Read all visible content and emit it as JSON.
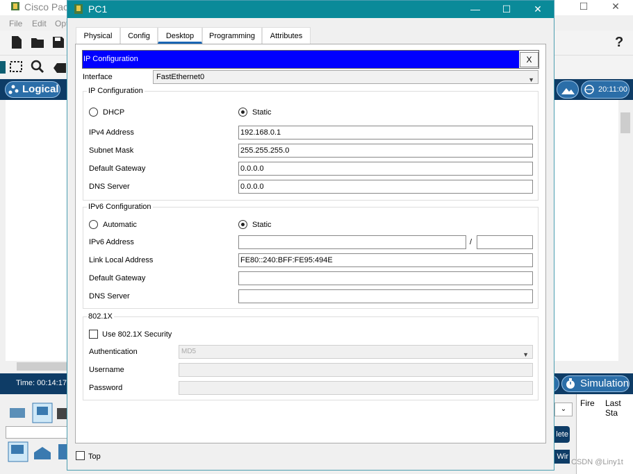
{
  "background_app": {
    "title": "Cisco Pac",
    "menu": [
      "File",
      "Edit",
      "Opt"
    ],
    "logical_label": "Logical",
    "clock": "20:11:00",
    "time_label": "Time: 00:14:17",
    "simulation_label": "Simulation",
    "help_label": "?",
    "event_list_headers": [
      "Fire",
      "Last Sta"
    ],
    "delete_label": "lete",
    "wir_label": "Wir",
    "select_arrow": "⌄",
    "watermark": "CSDN @Liny1t"
  },
  "dialog": {
    "title": "PC1",
    "tabs": [
      "Physical",
      "Config",
      "Desktop",
      "Programming",
      "Attributes"
    ],
    "active_tab": "Desktop",
    "panel_title": "IP Configuration",
    "close_label": "X",
    "interface_label": "Interface",
    "interface_value": "FastEthernet0",
    "ipv4": {
      "group_title": "IP Configuration",
      "dhcp_label": "DHCP",
      "static_label": "Static",
      "selected": "Static",
      "ipv4_label": "IPv4 Address",
      "ipv4_value": "192.168.0.1",
      "subnet_label": "Subnet Mask",
      "subnet_value": "255.255.255.0",
      "gateway_label": "Default Gateway",
      "gateway_value": "0.0.0.0",
      "dns_label": "DNS Server",
      "dns_value": "0.0.0.0"
    },
    "ipv6": {
      "group_title": "IPv6 Configuration",
      "automatic_label": "Automatic",
      "static_label": "Static",
      "selected": "Static",
      "ipv6_label": "IPv6 Address",
      "ipv6_value": "",
      "prefix_separator": "/",
      "prefix_value": "",
      "link_local_label": "Link Local Address",
      "link_local_value": "FE80::240:BFF:FE95:494E",
      "gateway_label": "Default Gateway",
      "gateway_value": "",
      "dns_label": "DNS Server",
      "dns_value": ""
    },
    "dot1x": {
      "group_title": "802.1X",
      "use_label": "Use 802.1X Security",
      "use_checked": false,
      "auth_label": "Authentication",
      "auth_value": "MD5",
      "username_label": "Username",
      "username_value": "",
      "password_label": "Password",
      "password_value": ""
    },
    "top_label": "Top",
    "top_checked": false
  },
  "colors": {
    "dialog_titlebar": "#0a8a99",
    "panel_header": "#0000ff",
    "app_bar": "#0e3c66"
  }
}
